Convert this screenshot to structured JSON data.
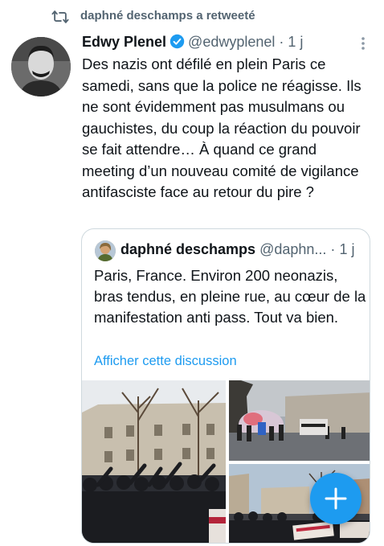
{
  "retweet": {
    "text": "daphné deschamps a retweeté",
    "icon": "retweet-icon"
  },
  "tweet": {
    "author_name": "Edwy Plenel",
    "handle": "@edwyplenel",
    "separator": "·",
    "time": "1 j",
    "text": "Des nazis ont défilé en plein Paris ce samedi, sans que la police ne réagisse. Ils ne sont évidemment pas musulmans ou gauchistes, du coup la réaction du pouvoir se fait attendre… À quand ce grand meeting d’un nouveau comité de vigilance antifasciste face au retour du pire ?"
  },
  "quote": {
    "author_name": "daphné deschamps",
    "handle": "@daphn...",
    "separator": "·",
    "time": "1 j",
    "text": "Paris, France. Environ 200 neonazis, bras tendus, en pleine rue, au cœur de la manifestation anti pass. Tout va bien.",
    "link": "Afficher cette discussion",
    "images": [
      "crowd-photo-street-salute",
      "protest-smoke-photo",
      "protest-banners-photo"
    ]
  },
  "colors": {
    "accent": "#1d9bf0",
    "muted": "#536471",
    "text": "#0f1419",
    "border": "#cfd9de"
  }
}
